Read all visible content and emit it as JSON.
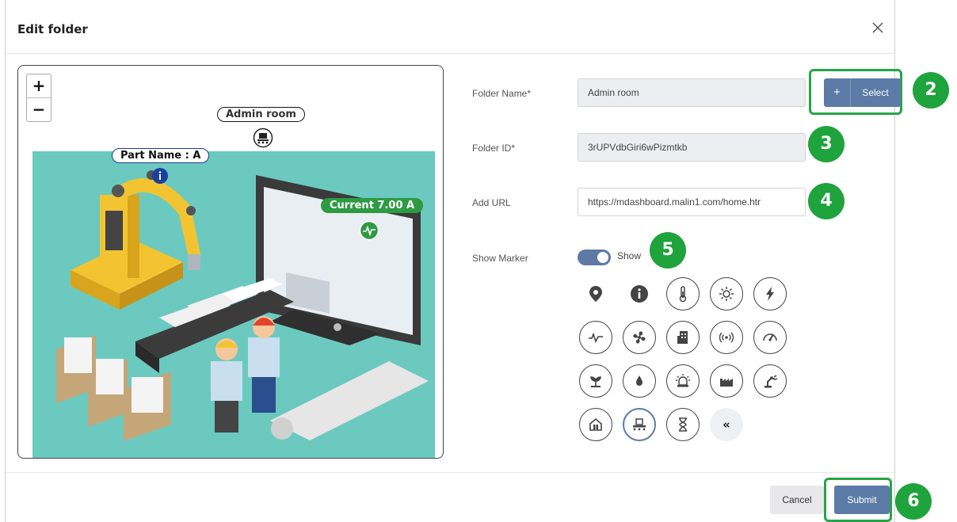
{
  "dialog": {
    "title": "Edit folder"
  },
  "map": {
    "zoom_in": "+",
    "zoom_out": "−",
    "folder_label": "Admin room",
    "part_label": "Part Name : A",
    "current_label": "Current 7.00 A",
    "scene_colors": {
      "background": "#6cc9c0"
    }
  },
  "form": {
    "folder_name_label": "Folder Name*",
    "folder_name_value": "Admin room",
    "select_plus": "+",
    "select_label": "Select",
    "folder_id_label": "Folder ID*",
    "folder_id_value": "3rUPVdbGiri6wPizmtkb",
    "add_url_label": "Add URL",
    "add_url_value": "https://mdashboard.malin1.com/home.htr",
    "show_marker_label": "Show Marker",
    "show_toggle_label": "Show",
    "show_toggle_on": true
  },
  "marker_icons": [
    "map-pin-icon",
    "info-icon",
    "thermometer-icon",
    "sun-icon",
    "bolt-icon",
    "pulse-icon",
    "fan-icon",
    "building-icon",
    "signal-icon",
    "gauge-icon",
    "plant-icon",
    "droplet-icon",
    "alarm-icon",
    "factory-icon",
    "robot-arm-icon",
    "house-icon",
    "conveyor-icon",
    "hourglass-icon",
    "collapse-icon"
  ],
  "selected_marker": "conveyor-icon",
  "collapse_glyph": "«",
  "badges": {
    "b2": "2",
    "b3": "3",
    "b4": "4",
    "b5": "5",
    "b6": "6"
  },
  "footer": {
    "cancel_label": "Cancel",
    "submit_label": "Submit"
  },
  "colors": {
    "accent": "#5c7ba6",
    "highlight": "#26a546"
  }
}
